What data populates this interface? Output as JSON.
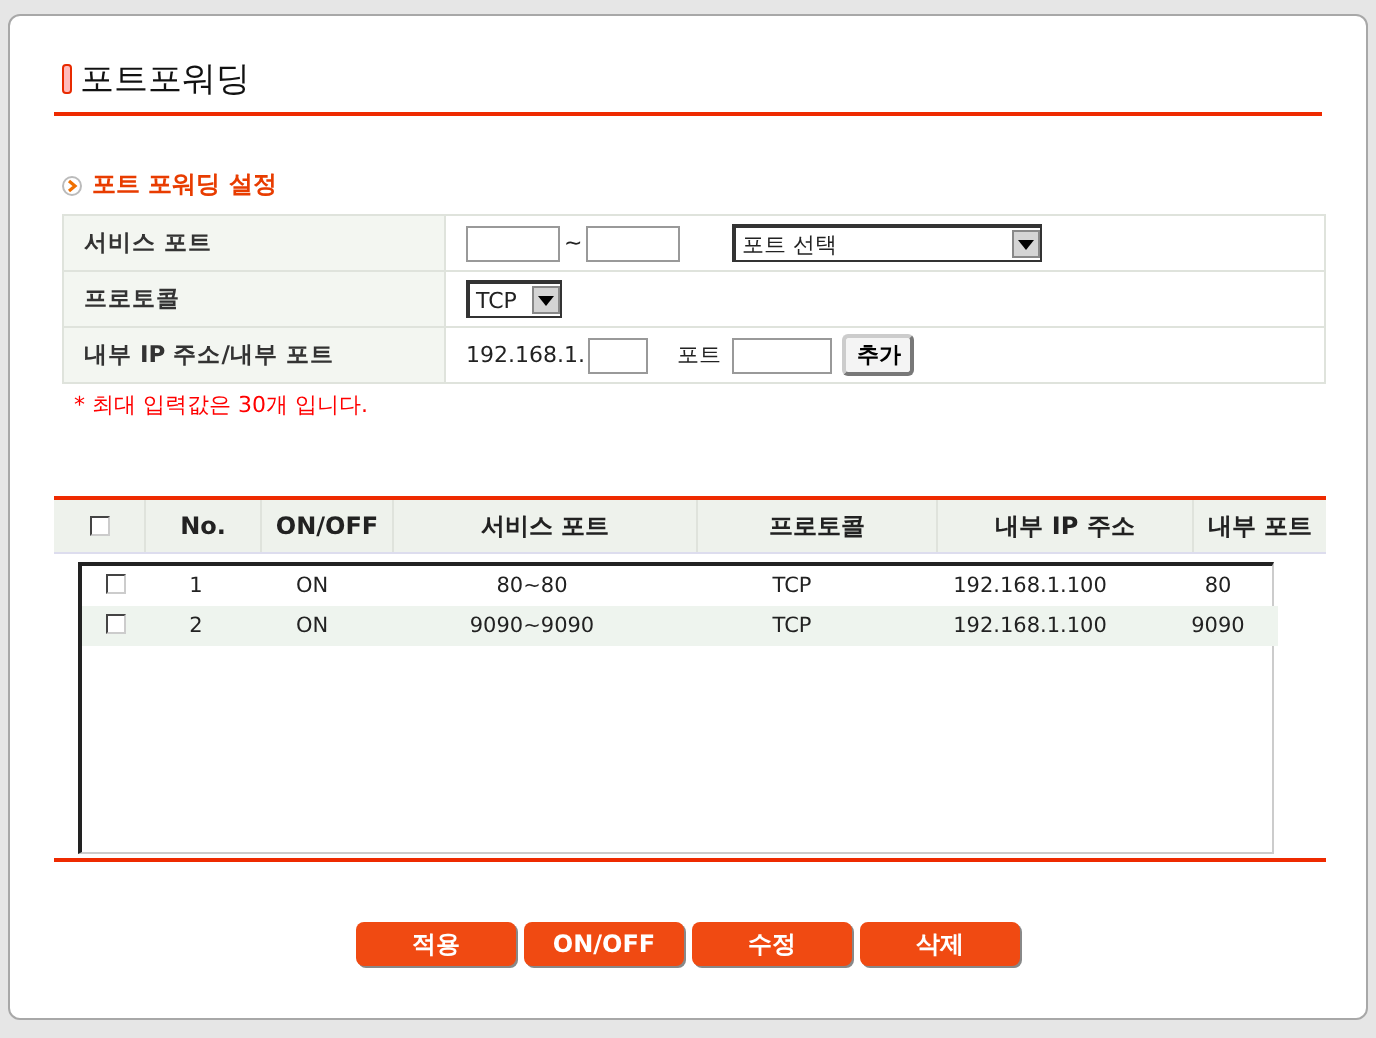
{
  "page_title": "포트포워딩",
  "section_title": "포트 포워딩 설정",
  "form": {
    "rows": [
      {
        "kind": "service",
        "label": "서비스 포트",
        "separator": "~",
        "select_value": "포트 선택"
      },
      {
        "kind": "protocol",
        "label": "프로토콜",
        "select_value": "TCP"
      },
      {
        "kind": "internal",
        "label": "내부 IP 주소/내부 포트",
        "ip_prefix": "192.168.1.",
        "port_label": "포트",
        "add_button": "추가"
      }
    ]
  },
  "note": "* 최대 입력값은 30개 입니다.",
  "table": {
    "select_all_checked": false,
    "columns": [
      "No.",
      "ON/OFF",
      "서비스 포트",
      "프로토콜",
      "내부 IP 주소",
      "내부 포트"
    ],
    "rows": [
      {
        "checked": false,
        "cells": [
          "1",
          "ON",
          "80~80",
          "TCP",
          "192.168.1.100",
          "80"
        ]
      },
      {
        "checked": false,
        "cells": [
          "2",
          "ON",
          "9090~9090",
          "TCP",
          "192.168.1.100",
          "9090"
        ]
      }
    ]
  },
  "buttons": [
    "적용",
    "ON/OFF",
    "수정",
    "삭제"
  ]
}
